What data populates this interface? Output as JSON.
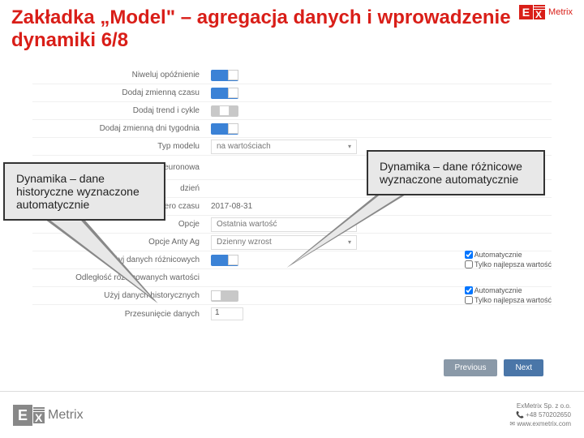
{
  "header": {
    "title": "Zakładka „Model\" – agregacja danych i wprowadzenie dynamiki 6/8",
    "brand_prefix": "E",
    "brand_x": "X",
    "brand_suffix": "Metrix"
  },
  "form": {
    "rows": {
      "r1": "Niweluj opóźnienie",
      "r2": "Dodaj zmienną czasu",
      "r3": "Dodaj trend i cykle",
      "r4": "Dodaj zmienną dni tygodnia",
      "r5": "Typ modelu",
      "r5_val": "na wartościach",
      "r6": "Sieć neuronowa",
      "r6_sub": "dzień",
      "r7": "Punkt zero czasu",
      "r7_val": "2017-08-31",
      "r8": "Opcje",
      "r8_val": "Ostatnia wartość",
      "r9": "Opcje Anty Ag",
      "r9_val": "Dzienny wzrost",
      "r10": "Użyj danych różnicowych",
      "r11": "Odległość różnicowanych wartości",
      "r12": "Użyj danych historycznych",
      "r13": "Przesunięcie danych",
      "r13_val": "1",
      "chk_auto": "Automatycznie",
      "chk_best": "Tylko najlepsza wartość"
    }
  },
  "callouts": {
    "left": "Dynamika – dane historyczne wyznaczone automatycznie",
    "right": "Dynamika – dane różnicowe wyznaczone automatycznie"
  },
  "buttons": {
    "prev": "Previous",
    "next": "Next"
  },
  "footer": {
    "company": "ExMetrix Sp. z o.o.",
    "phone": "+48 570202650",
    "site": "www.exmetrix.com"
  }
}
